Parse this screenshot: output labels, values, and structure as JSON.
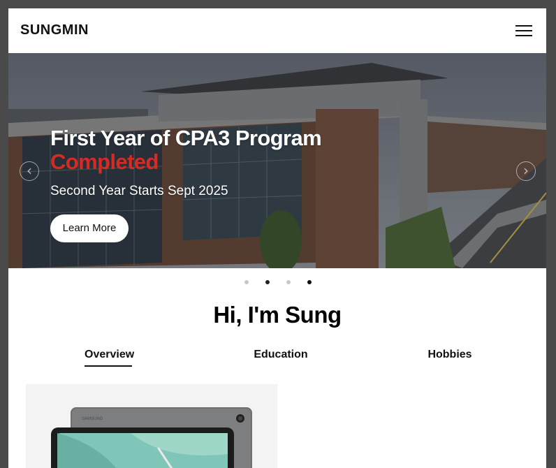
{
  "header": {
    "logo": "SUNGMIN",
    "menu_icon": "hamburger-menu-icon"
  },
  "hero": {
    "title": "First Year of CPA3 Program",
    "highlight": "Completed",
    "subtitle": "Second Year Starts Sept 2025",
    "cta_label": "Learn More",
    "prev_icon": "chevron-left-icon",
    "next_icon": "chevron-right-icon",
    "highlight_color": "#d62b22"
  },
  "carousel": {
    "total_slides": 4,
    "active_slide": 4
  },
  "intro": {
    "heading": "Hi, I'm Sung"
  },
  "tabs": [
    {
      "label": "Overview",
      "active": true
    },
    {
      "label": "Education",
      "active": false
    },
    {
      "label": "Hobbies",
      "active": false
    }
  ],
  "product_card": {
    "image": "tablet-device-image",
    "brand_mark": "SAMSUNG"
  }
}
